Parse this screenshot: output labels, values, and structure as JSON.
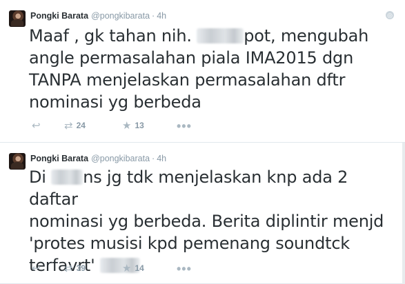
{
  "tweets": [
    {
      "name": "Pongki Barata",
      "handle": "@pongkibarata",
      "separator": "·",
      "time": "4h",
      "text_lines": [
        {
          "before": "Maaf , gk tahan nih. ",
          "after": "pot, mengubah"
        },
        {
          "text": "angle permasalahan piala IMA2015 dgn"
        },
        {
          "text": "TANPA menjelaskan permasalahan dftr"
        },
        {
          "text": "nominasi yg berbeda"
        }
      ],
      "retweets": "24",
      "favorites": "13"
    },
    {
      "name": "Pongki Barata",
      "handle": "@pongkibarata",
      "separator": "·",
      "time": "4h",
      "text_lines": [
        {
          "before": "Di ",
          "after": "ns jg tdk menjelaskan knp ada 2 daftar"
        },
        {
          "text": "nominasi yg berbeda. Berita diplintir menjd"
        },
        {
          "text": "'protes musisi kpd pemenang soundtck"
        },
        {
          "before": "terfavrt' ",
          "after": ""
        }
      ],
      "retweets": "39",
      "favorites": "14"
    }
  ],
  "icons": {
    "reply": "reply-icon",
    "retweet": "retweet-icon",
    "favorite": "star-icon",
    "more": "more-icon",
    "globe": "globe-icon"
  },
  "colors": {
    "name": "#292f33",
    "meta": "#8899a6",
    "icon": "#aab8c2",
    "divider": "#e1e8ed"
  }
}
